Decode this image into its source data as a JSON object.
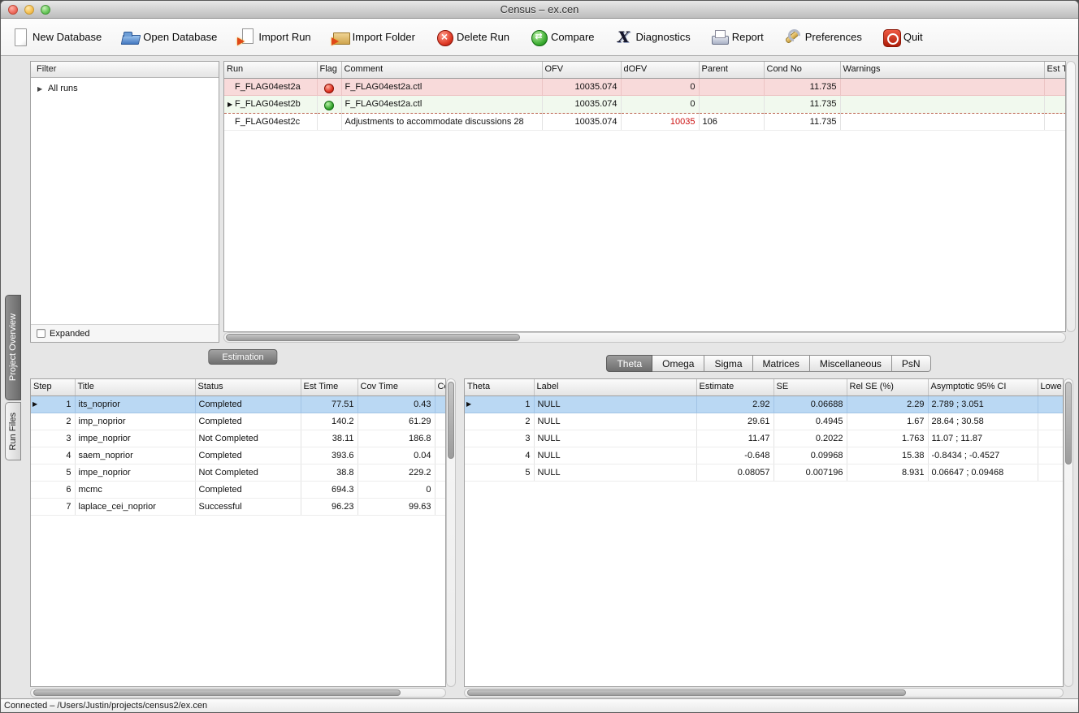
{
  "window": {
    "title": "Census – ex.cen"
  },
  "toolbar": {
    "items": [
      {
        "label": "New Database",
        "icon": "new-database-icon"
      },
      {
        "label": "Open Database",
        "icon": "open-database-icon"
      },
      {
        "label": "Import Run",
        "icon": "import-run-icon"
      },
      {
        "label": "Import Folder",
        "icon": "import-folder-icon"
      },
      {
        "label": "Delete Run",
        "icon": "delete-run-icon"
      },
      {
        "label": "Compare",
        "icon": "compare-icon"
      },
      {
        "label": "Diagnostics",
        "icon": "diagnostics-icon"
      },
      {
        "label": "Report",
        "icon": "report-icon"
      },
      {
        "label": "Preferences",
        "icon": "preferences-icon"
      },
      {
        "label": "Quit",
        "icon": "quit-icon"
      }
    ]
  },
  "side_tabs": [
    {
      "label": "Project Overview",
      "selected": true
    },
    {
      "label": "Run Files",
      "selected": false
    }
  ],
  "filter": {
    "title": "Filter",
    "root_item": {
      "arrow": "▶",
      "label": "All runs"
    },
    "expanded": {
      "label": "Expanded",
      "checked": false
    }
  },
  "runs_table": {
    "columns": [
      "Run",
      "Flag",
      "Comment",
      "OFV",
      "dOFV",
      "Parent",
      "Cond No",
      "Warnings",
      "Est T"
    ],
    "rows": [
      {
        "run": "F_FLAG04est2a",
        "flag": "red",
        "comment": "F_FLAG04est2a.ctl",
        "ofv": "10035.074",
        "dofv": "0",
        "parent": "",
        "cond_no": "11.735",
        "warnings": "",
        "est_t": "",
        "row_class": "row-red"
      },
      {
        "marker": "▶",
        "run": "F_FLAG04est2b",
        "flag": "green",
        "comment": "F_FLAG04est2a.ctl",
        "ofv": "10035.074",
        "dofv": "0",
        "parent": "",
        "cond_no": "11.735",
        "warnings": "",
        "est_t": "",
        "row_class": "row-green current"
      },
      {
        "run": "F_FLAG04est2c",
        "flag": "",
        "comment": "Adjustments to accommodate discussions 28",
        "ofv": "10035.074",
        "dofv": "10035",
        "dofv_class": "red-text",
        "parent": "106",
        "cond_no": "11.735",
        "warnings": "",
        "est_t": ""
      }
    ]
  },
  "estimation": {
    "title": "Estimation",
    "columns": [
      "Step",
      "Title",
      "Status",
      "Est Time",
      "Cov Time",
      "Co"
    ],
    "rows": [
      {
        "marker": "▶",
        "step": "1",
        "title": "its_noprior",
        "status": "Completed",
        "est_time": "77.51",
        "cov_time": "0.43",
        "row_class": "selected current"
      },
      {
        "step": "2",
        "title": "imp_noprior",
        "status": "Completed",
        "est_time": "140.2",
        "cov_time": "61.29"
      },
      {
        "step": "3",
        "title": "impe_noprior",
        "status": "Not Completed",
        "est_time": "38.11",
        "cov_time": "186.8"
      },
      {
        "step": "4",
        "title": "saem_noprior",
        "status": "Completed",
        "est_time": "393.6",
        "cov_time": "0.04"
      },
      {
        "step": "5",
        "title": "impe_noprior",
        "status": "Not Completed",
        "est_time": "38.8",
        "cov_time": "229.2"
      },
      {
        "step": "6",
        "title": "mcmc",
        "status": "Completed",
        "est_time": "694.3",
        "cov_time": "0"
      },
      {
        "step": "7",
        "title": "laplace_cei_noprior",
        "status": "Successful",
        "est_time": "96.23",
        "cov_time": "99.63"
      }
    ]
  },
  "results": {
    "tabs": [
      {
        "label": "Theta",
        "selected": true
      },
      {
        "label": "Omega"
      },
      {
        "label": "Sigma"
      },
      {
        "label": "Matrices"
      },
      {
        "label": "Miscellaneous"
      },
      {
        "label": "PsN"
      }
    ],
    "columns": [
      "Theta",
      "Label",
      "Estimate",
      "SE",
      "Rel SE (%)",
      "Asymptotic 95% CI",
      "Lowe"
    ],
    "rows": [
      {
        "marker": "▶",
        "theta": "1",
        "label": "NULL",
        "estimate": "2.92",
        "se": "0.06688",
        "rel_se": "2.29",
        "ci": "2.789 ; 3.051",
        "row_class": "selected current"
      },
      {
        "theta": "2",
        "label": "NULL",
        "estimate": "29.61",
        "se": "0.4945",
        "rel_se": "1.67",
        "ci": "28.64 ; 30.58"
      },
      {
        "theta": "3",
        "label": "NULL",
        "estimate": "11.47",
        "se": "0.2022",
        "rel_se": "1.763",
        "ci": "11.07 ; 11.87"
      },
      {
        "theta": "4",
        "label": "NULL",
        "estimate": "-0.648",
        "se": "0.09968",
        "rel_se": "15.38",
        "ci": "-0.8434 ; -0.4527"
      },
      {
        "theta": "5",
        "label": "NULL",
        "estimate": "0.08057",
        "se": "0.007196",
        "rel_se": "8.931",
        "ci": "0.06647 ; 0.09468"
      }
    ]
  },
  "status_bar": {
    "text": "Connected –  /Users/Justin/projects/census2/ex.cen"
  }
}
